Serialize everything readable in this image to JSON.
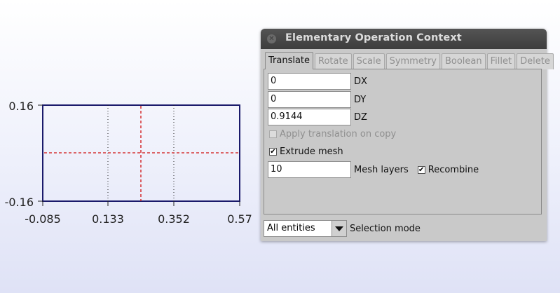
{
  "viewport": {
    "y_axis": {
      "min_label": "-0.16",
      "max_label": "0.16"
    },
    "x_axis": {
      "tick_labels": [
        "-0.085",
        "0.133",
        "0.352",
        "0.57"
      ]
    }
  },
  "dialog": {
    "title": "Elementary Operation Context",
    "tabs": [
      {
        "label": "Translate",
        "active": true
      },
      {
        "label": "Rotate"
      },
      {
        "label": "Scale"
      },
      {
        "label": "Symmetry"
      },
      {
        "label": "Boolean"
      },
      {
        "label": "Fillet"
      },
      {
        "label": "Delete"
      }
    ],
    "translate": {
      "dx": {
        "value": "0",
        "label": "DX"
      },
      "dy": {
        "value": "0",
        "label": "DY"
      },
      "dz": {
        "value": "0.9144",
        "label": "DZ"
      },
      "apply_on_copy": {
        "label": "Apply translation on copy",
        "checked": false,
        "enabled": false
      },
      "extrude_mesh": {
        "label": "Extrude mesh",
        "checked": true
      },
      "mesh_layers": {
        "value": "10",
        "label": "Mesh layers"
      },
      "recombine": {
        "label": "Recombine",
        "checked": true
      }
    },
    "selection": {
      "value": "All entities",
      "label": "Selection mode"
    }
  },
  "colors": {
    "box": "#1a1a6b",
    "crosshair": "#d01010",
    "grid": "#222222"
  }
}
